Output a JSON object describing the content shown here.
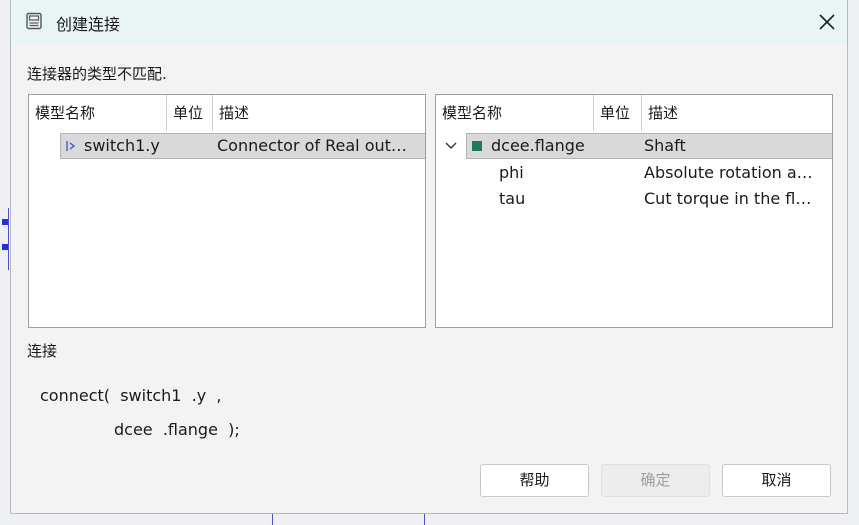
{
  "window": {
    "title": "创建连接",
    "icon": "dialog-app-icon",
    "close": "close-icon"
  },
  "message": "连接器的类型不匹配.",
  "left_panel": {
    "headers": [
      "模型名称",
      "单位",
      "描述"
    ],
    "rows": [
      {
        "name": "switch1.y",
        "unit": "",
        "desc": "Connector of Real out…",
        "icon": "output-connector-icon",
        "selected": true
      }
    ]
  },
  "right_panel": {
    "headers": [
      "模型名称",
      "单位",
      "描述"
    ],
    "rows": [
      {
        "name": "dcee.flange",
        "unit": "",
        "desc": "Shaft",
        "icon": "flange-connector-icon",
        "expander": "chevron-down-icon",
        "selected": true
      },
      {
        "name": "phi",
        "unit": "",
        "desc": "Absolute rotation a…"
      },
      {
        "name": "tau",
        "unit": "",
        "desc": "Cut torque in the fl…"
      }
    ]
  },
  "connection": {
    "label": "连接",
    "line1": "connect(  switch1  .y  ,",
    "line2": "dcee  .flange  );"
  },
  "buttons": {
    "help": "帮助",
    "ok": "确定",
    "cancel": "取消"
  },
  "colors": {
    "titlebar": "#e9f4f4",
    "selection": "#d9d9d9",
    "flange_icon": "#1f7a5c",
    "canvas_wire": "#4a52c9"
  }
}
